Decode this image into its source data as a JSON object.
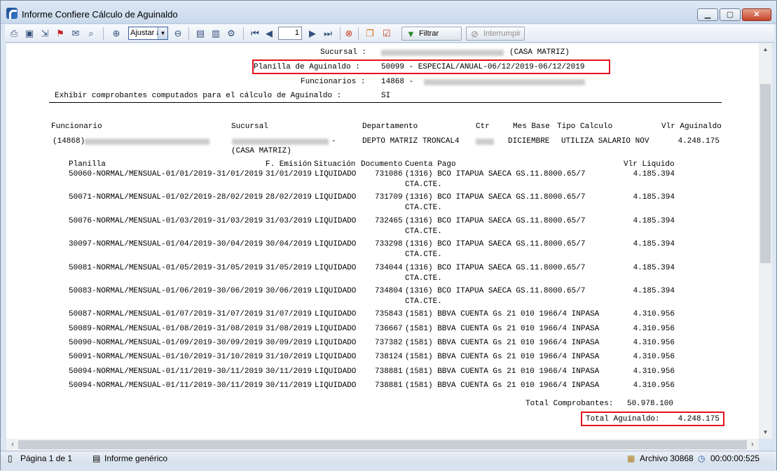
{
  "window": {
    "title": "Informe Confiere Cálculo de Aguinaldo",
    "controls": {
      "minimize": "▁",
      "maximize": "▢",
      "close": "✕"
    }
  },
  "toolbar": {
    "zoom_value": "Ajustar a",
    "page_value": "1",
    "filtrar_label": "Filtrar",
    "interrumpir_label": "Interrumpir",
    "icons": [
      "print-icon",
      "save-icon",
      "export-icon",
      "pdf-icon",
      "mail-icon",
      "find-icon",
      "zoom-in-icon",
      "zoom-out-icon",
      "page-setup-icon",
      "layout-icon",
      "properties-icon",
      "first-page-icon",
      "prev-page-icon",
      "next-page-icon",
      "last-page-icon",
      "stop-icon",
      "copy-icon",
      "check-icon",
      "filter-icon",
      "interrupt-icon"
    ]
  },
  "report": {
    "sucursal_label": "Sucursal :",
    "sucursal_value": "(CASA MATRIZ)",
    "planilla_label": "Planilla de Aguinaldo :",
    "planilla_value": "50099 - ESPECIAL/ANUAL-06/12/2019-06/12/2019",
    "funcionarios_label": "Funcionarios :",
    "funcionarios_value": "14868 -",
    "exhibir_label": "Exhibir comprobantes computados para el cálculo de Aguinaldo :",
    "exhibir_value": "SI",
    "headers": {
      "funcionario": "Funcionario",
      "sucursal": "Sucursal",
      "departamento": "Departamento",
      "ctr": "Ctr",
      "mes_base": "Mes Base",
      "tipo_calculo": "Tipo Calculo",
      "vlr_aguinaldo": "Vlr Aguinaldo"
    },
    "employee": {
      "id": "(14868)",
      "sucursal_suffix": "-",
      "sucursal_line2": "(CASA MATRIZ)",
      "departamento": "DEPTO MATRIZ TRONCAL4",
      "mes_base": "DICIEMBRE",
      "tipo_calculo": "UTILIZA SALARIO NOV",
      "vlr_aguinaldo": "4.248.175"
    },
    "detail_headers": {
      "planilla": "Planilla",
      "f_emision": "F. Emisión",
      "situacion": "Situación",
      "documento": "Documento",
      "cuenta_pago": "Cuenta Pago",
      "vlr_liquido": "Vlr Liquido"
    },
    "rows": [
      {
        "planilla": "50060-NORMAL/MENSUAL-01/01/2019-31/01/2019",
        "fecha": "31/01/2019",
        "situacion": "LIQUIDADO",
        "documento": "731086",
        "cuenta": "(1316) BCO ITAPUA SAECA GS.11.8000.65/7",
        "cuenta2": "CTA.CTE.",
        "valor": "4.185.394"
      },
      {
        "planilla": "50071-NORMAL/MENSUAL-01/02/2019-28/02/2019",
        "fecha": "28/02/2019",
        "situacion": "LIQUIDADO",
        "documento": "731709",
        "cuenta": "(1316) BCO ITAPUA SAECA GS.11.8000.65/7",
        "cuenta2": "CTA.CTE.",
        "valor": "4.185.394"
      },
      {
        "planilla": "50076-NORMAL/MENSUAL-01/03/2019-31/03/2019",
        "fecha": "31/03/2019",
        "situacion": "LIQUIDADO",
        "documento": "732465",
        "cuenta": "(1316) BCO ITAPUA SAECA GS.11.8000.65/7",
        "cuenta2": "CTA.CTE.",
        "valor": "4.185.394"
      },
      {
        "planilla": "30097-NORMAL/MENSUAL-01/04/2019-30/04/2019",
        "fecha": "30/04/2019",
        "situacion": "LIQUIDADO",
        "documento": "733298",
        "cuenta": "(1316) BCO ITAPUA SAECA GS.11.8000.65/7",
        "cuenta2": "CTA.CTE.",
        "valor": "4.185.394"
      },
      {
        "planilla": "50081-NORMAL/MENSUAL-01/05/2019-31/05/2019",
        "fecha": "31/05/2019",
        "situacion": "LIQUIDADO",
        "documento": "734044",
        "cuenta": "(1316) BCO ITAPUA SAECA GS.11.8000.65/7",
        "cuenta2": "CTA.CTE.",
        "valor": "4.185.394"
      },
      {
        "planilla": "50083-NORMAL/MENSUAL-01/06/2019-30/06/2019",
        "fecha": "30/06/2019",
        "situacion": "LIQUIDADO",
        "documento": "734804",
        "cuenta": "(1316) BCO ITAPUA SAECA GS.11.8000.65/7",
        "cuenta2": "CTA.CTE.",
        "valor": "4.185.394"
      },
      {
        "planilla": "50087-NORMAL/MENSUAL-01/07/2019-31/07/2019",
        "fecha": "31/07/2019",
        "situacion": "LIQUIDADO",
        "documento": "735843",
        "cuenta": "(1581) BBVA CUENTA Gs 21 010 1966/4 INPASA",
        "cuenta2": "",
        "valor": "4.310.956"
      },
      {
        "planilla": "50089-NORMAL/MENSUAL-01/08/2019-31/08/2019",
        "fecha": "31/08/2019",
        "situacion": "LIQUIDADO",
        "documento": "736667",
        "cuenta": "(1581) BBVA CUENTA Gs 21 010 1966/4 INPASA",
        "cuenta2": "",
        "valor": "4.310.956"
      },
      {
        "planilla": "50090-NORMAL/MENSUAL-01/09/2019-30/09/2019",
        "fecha": "30/09/2019",
        "situacion": "LIQUIDADO",
        "documento": "737382",
        "cuenta": "(1581) BBVA CUENTA Gs 21 010 1966/4 INPASA",
        "cuenta2": "",
        "valor": "4.310.956"
      },
      {
        "planilla": "50091-NORMAL/MENSUAL-01/10/2019-31/10/2019",
        "fecha": "31/10/2019",
        "situacion": "LIQUIDADO",
        "documento": "738124",
        "cuenta": "(1581) BBVA CUENTA Gs 21 010 1966/4 INPASA",
        "cuenta2": "",
        "valor": "4.310.956"
      },
      {
        "planilla": "50094-NORMAL/MENSUAL-01/11/2019-30/11/2019",
        "fecha": "30/11/2019",
        "situacion": "LIQUIDADO",
        "documento": "738881",
        "cuenta": "(1581) BBVA CUENTA Gs 21 010 1966/4 INPASA",
        "cuenta2": "",
        "valor": "4.310.956"
      },
      {
        "planilla": "50094-NORMAL/MENSUAL-01/11/2019-30/11/2019",
        "fecha": "30/11/2019",
        "situacion": "LIQUIDADO",
        "documento": "738881",
        "cuenta": "(1581) BBVA CUENTA Gs 21 010 1966/4 INPASA",
        "cuenta2": "",
        "valor": "4.310.956"
      }
    ],
    "total_comprobantes_label": "Total Comprobantes:",
    "total_comprobantes_value": "50.978.100",
    "total_aguinaldo_label": "Total Aguinaldo:",
    "total_aguinaldo_value": "4.248.175"
  },
  "statusbar": {
    "page": "Página 1 de 1",
    "informe": "Informe genérico",
    "archivo": "Archivo 30868",
    "time": "00:00:00:525"
  },
  "colors": {
    "highlight_box": "#e3141b",
    "title_bar": "#dfe9f5"
  }
}
